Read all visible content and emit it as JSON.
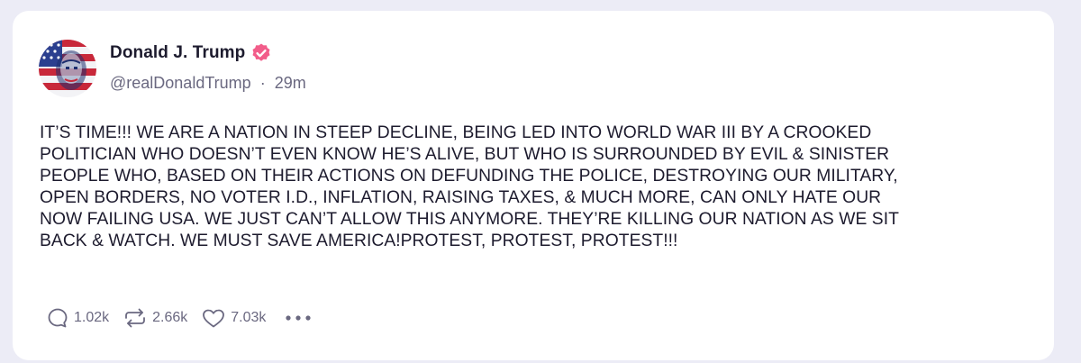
{
  "post": {
    "author_name": "Donald J. Trump",
    "handle": "@realDonaldTrump",
    "separator": "·",
    "time": "29m",
    "text": "IT’S TIME!!! WE ARE A NATION IN STEEP DECLINE, BEING LED INTO WORLD WAR III BY A CROOKED\nPOLITICIAN WHO DOESN’T EVEN KNOW HE’S ALIVE, BUT WHO IS SURROUNDED BY EVIL & SINISTER\nPEOPLE WHO, BASED ON THEIR ACTIONS ON DEFUNDING THE POLICE, DESTROYING OUR MILITARY,\nOPEN BORDERS, NO VOTER I.D., INFLATION, RAISING TAXES, & MUCH MORE, CAN ONLY HATE OUR\nNOW FAILING USA. WE JUST CAN’T ALLOW THIS ANYMORE. THEY’RE  KILLING OUR NATION AS WE SIT\nBACK & WATCH. WE MUST SAVE AMERICA!PROTEST, PROTEST, PROTEST!!!"
  },
  "actions": {
    "replies": "1.02k",
    "reposts": "2.66k",
    "likes": "7.03k",
    "reply_icon": "reply-icon",
    "repost_icon": "repost-icon",
    "like_icon": "heart-icon",
    "more_icon": "more-icon"
  },
  "colors": {
    "verified": "#f25d8a",
    "text": "#1d1b2e",
    "muted": "#6a6880",
    "background": "#ececf6"
  }
}
